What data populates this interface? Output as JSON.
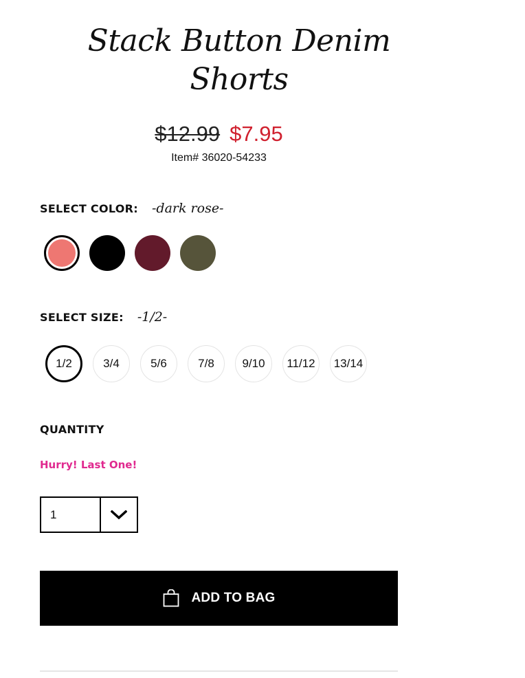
{
  "product": {
    "title": "Stack Button Denim Shorts",
    "price_original": "$12.99",
    "price_sale": "$7.95",
    "item_number": "Item# 36020-54233"
  },
  "color": {
    "label": "SELECT COLOR:",
    "selected": "-dark rose-",
    "swatches": [
      {
        "name": "dark rose",
        "hex": "#ee7772",
        "selected": true
      },
      {
        "name": "black",
        "hex": "#000000",
        "selected": false
      },
      {
        "name": "burgundy",
        "hex": "#621a2b",
        "selected": false
      },
      {
        "name": "olive",
        "hex": "#56543a",
        "selected": false
      }
    ]
  },
  "size": {
    "label": "SELECT SIZE:",
    "selected": "-1/2-",
    "options": [
      "1/2",
      "3/4",
      "5/6",
      "7/8",
      "9/10",
      "11/12",
      "13/14"
    ]
  },
  "quantity": {
    "label": "QUANTITY",
    "stock_message": "Hurry! Last One!",
    "value": "1",
    "dropdown_icon": "chevron-down-icon"
  },
  "cart": {
    "add_label": "ADD TO BAG",
    "icon": "shopping-bag-icon"
  },
  "colors": {
    "sale_price": "#d0202e",
    "stock_message": "#e0298f",
    "button_bg": "#000000"
  }
}
